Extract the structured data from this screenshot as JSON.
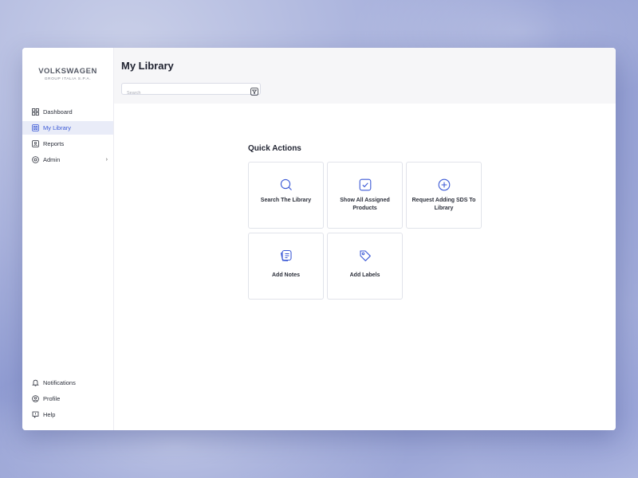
{
  "brand": {
    "name": "VOLKSWAGEN",
    "sub": "GROUP ITALIA S.P.A."
  },
  "sidebar": {
    "items": [
      {
        "label": "Dashboard",
        "icon": "grid-icon"
      },
      {
        "label": "My Library",
        "icon": "library-icon",
        "active": true
      },
      {
        "label": "Reports",
        "icon": "reports-icon"
      },
      {
        "label": "Admin",
        "icon": "admin-icon",
        "chevron": "›"
      }
    ],
    "bottom": [
      {
        "label": "Notifications",
        "icon": "bell-icon"
      },
      {
        "label": "Profile",
        "icon": "user-icon"
      },
      {
        "label": "Help",
        "icon": "help-icon"
      }
    ]
  },
  "header": {
    "title": "My Library",
    "search_placeholder": "Search"
  },
  "quick_actions": {
    "title": "Quick Actions",
    "cards": [
      {
        "label": "Search The Library",
        "icon": "search-icon"
      },
      {
        "label": "Show All Assigned Products",
        "icon": "check-square-icon"
      },
      {
        "label": "Request Adding SDS To Library",
        "icon": "plus-circle-icon"
      },
      {
        "label": "Add Notes",
        "icon": "notes-icon"
      },
      {
        "label": "Add Labels",
        "icon": "tag-icon"
      }
    ]
  },
  "colors": {
    "accent": "#3c5ad6",
    "active_bg": "#e9ecf8"
  }
}
